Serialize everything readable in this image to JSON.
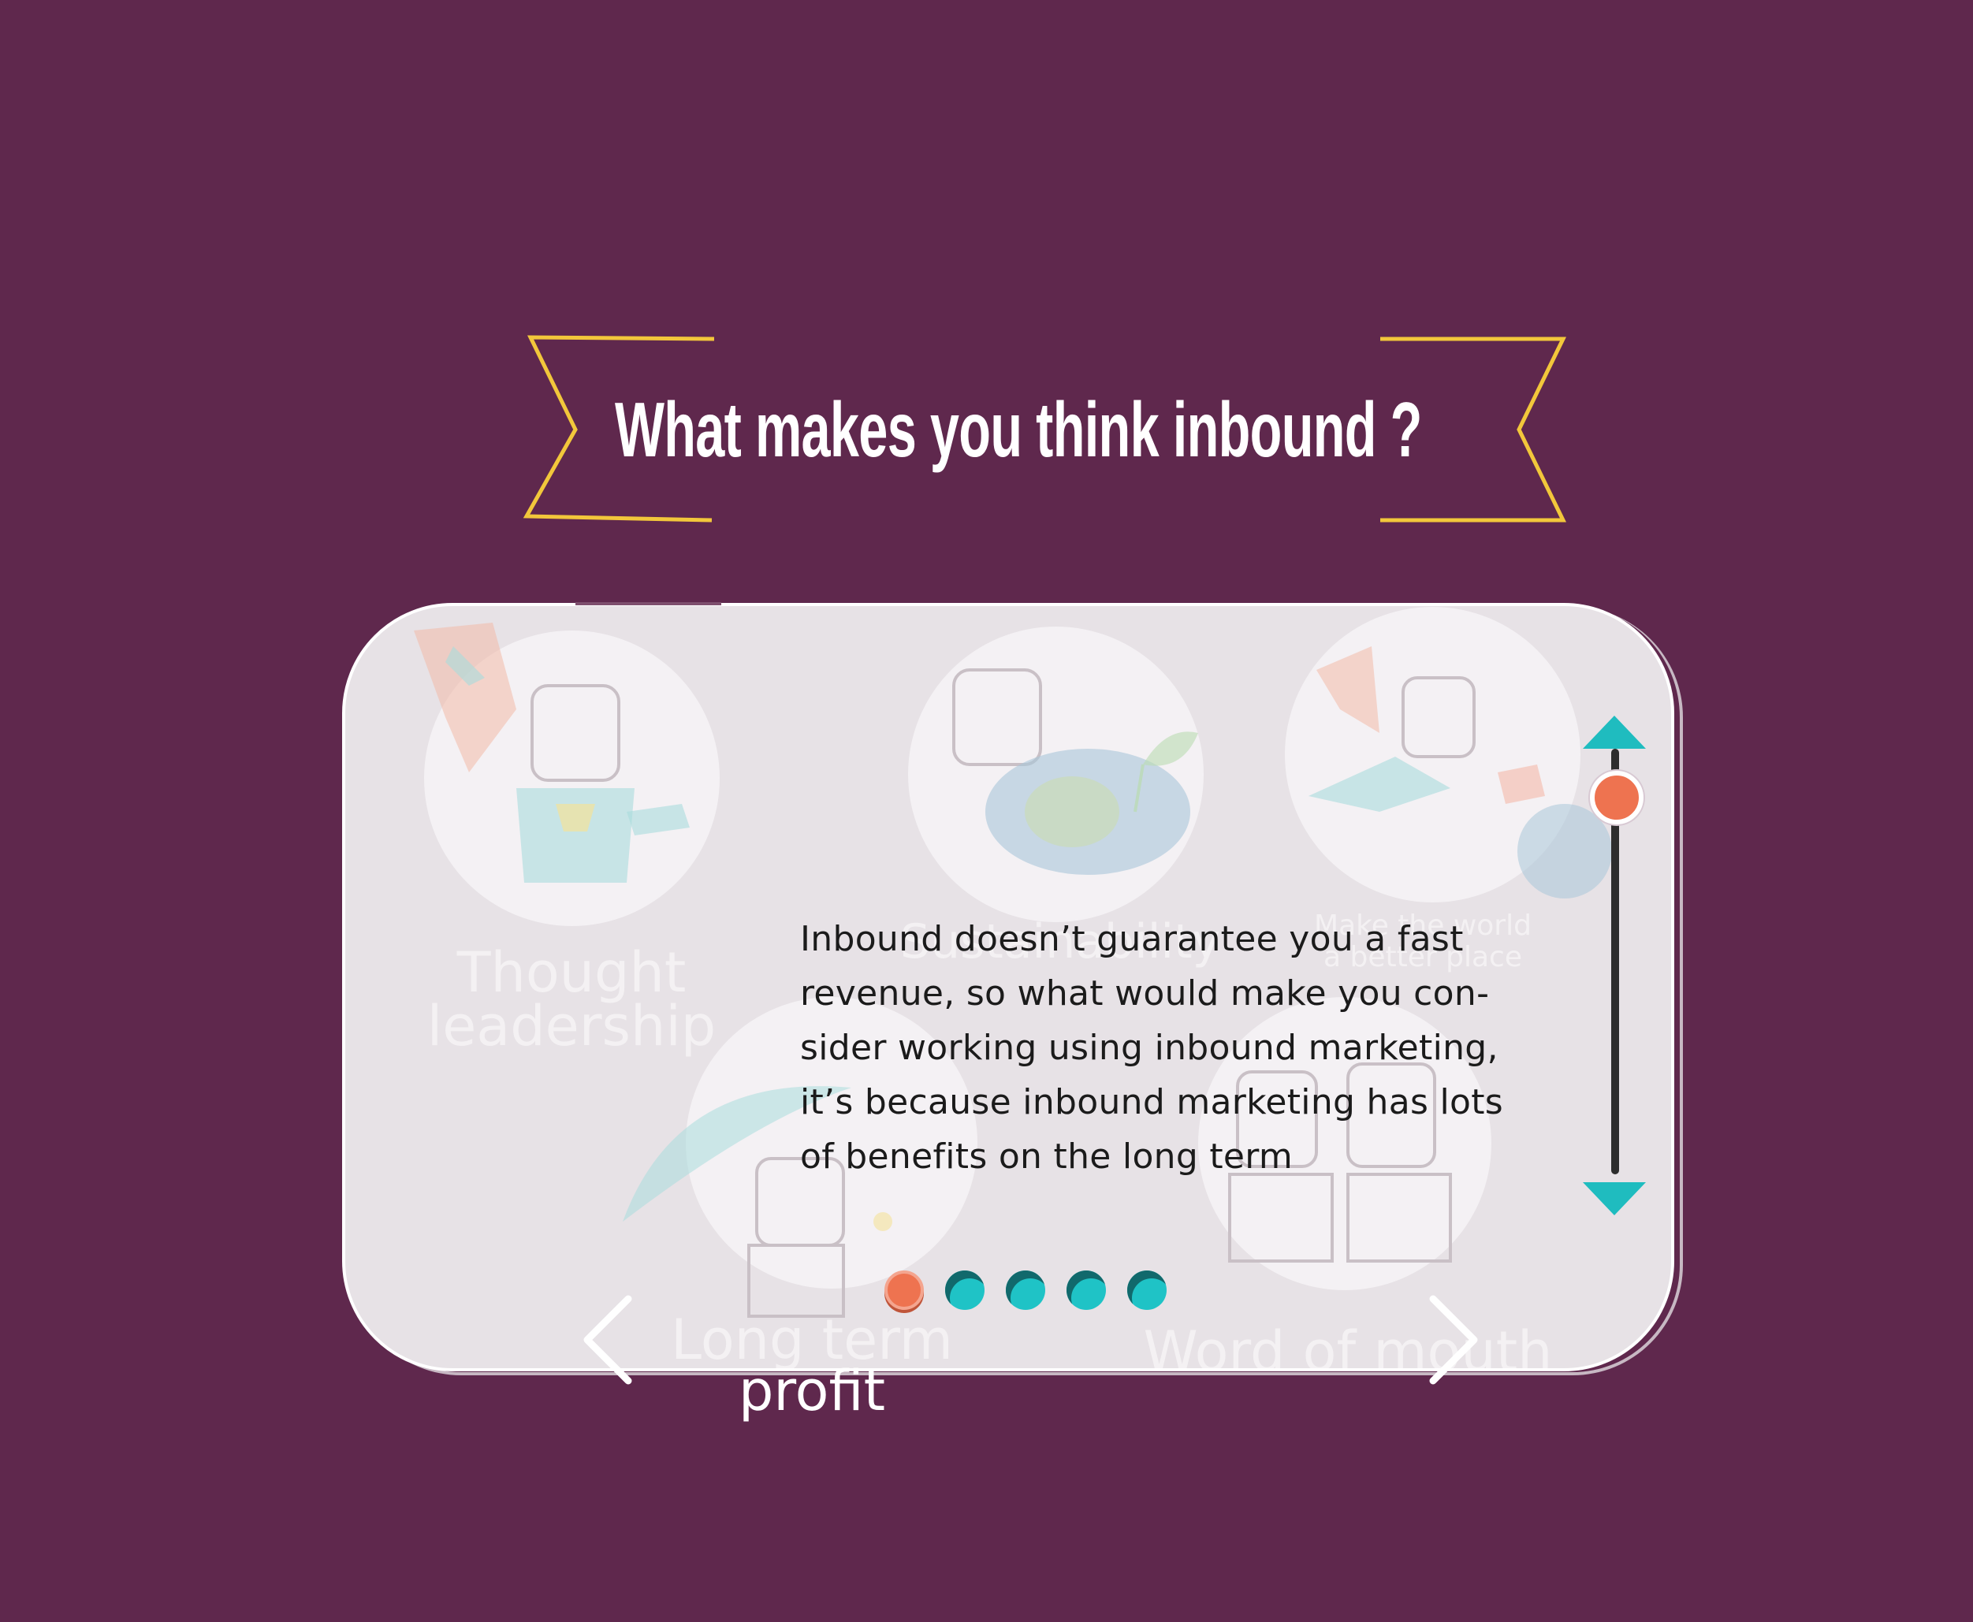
{
  "header": {
    "title": "What makes you think inbound ?"
  },
  "benefits": [
    {
      "label_line1": "Thought",
      "label_line2": "leadership",
      "icon": "superhero-icon"
    },
    {
      "label_line1": "Sustainability",
      "label_line2": "",
      "icon": "earth-plant-icon"
    },
    {
      "label_line1": "Make the world",
      "label_line2": "a better place",
      "icon": "flying-hero-icon"
    },
    {
      "label_line1": "Long term",
      "label_line2": "profit",
      "icon": "umbrella-icon"
    },
    {
      "label_line1": "Word of mouth",
      "label_line2": "",
      "icon": "talking-people-icon"
    }
  ],
  "description": "Inbound doesn’t guarantee  you a fast\nrevenue, so what would make you con-\nsider working using inbound marketing,\nit’s because inbound marketing has lots\nof benefits on the long term",
  "scroll": {
    "position": 0.0,
    "up_icon": "triangle-up-icon",
    "down_icon": "triangle-down-icon"
  },
  "pagination": {
    "total": 5,
    "active_index": 0
  },
  "navigation": {
    "prev_icon": "chevron-left-icon",
    "next_icon": "chevron-right-icon"
  },
  "colors": {
    "background": "#5f284d",
    "banner": "#f2c73b",
    "card": "#e7e2e6",
    "accent_orange": "#ee7350",
    "accent_teal": "#1fbcbf"
  }
}
